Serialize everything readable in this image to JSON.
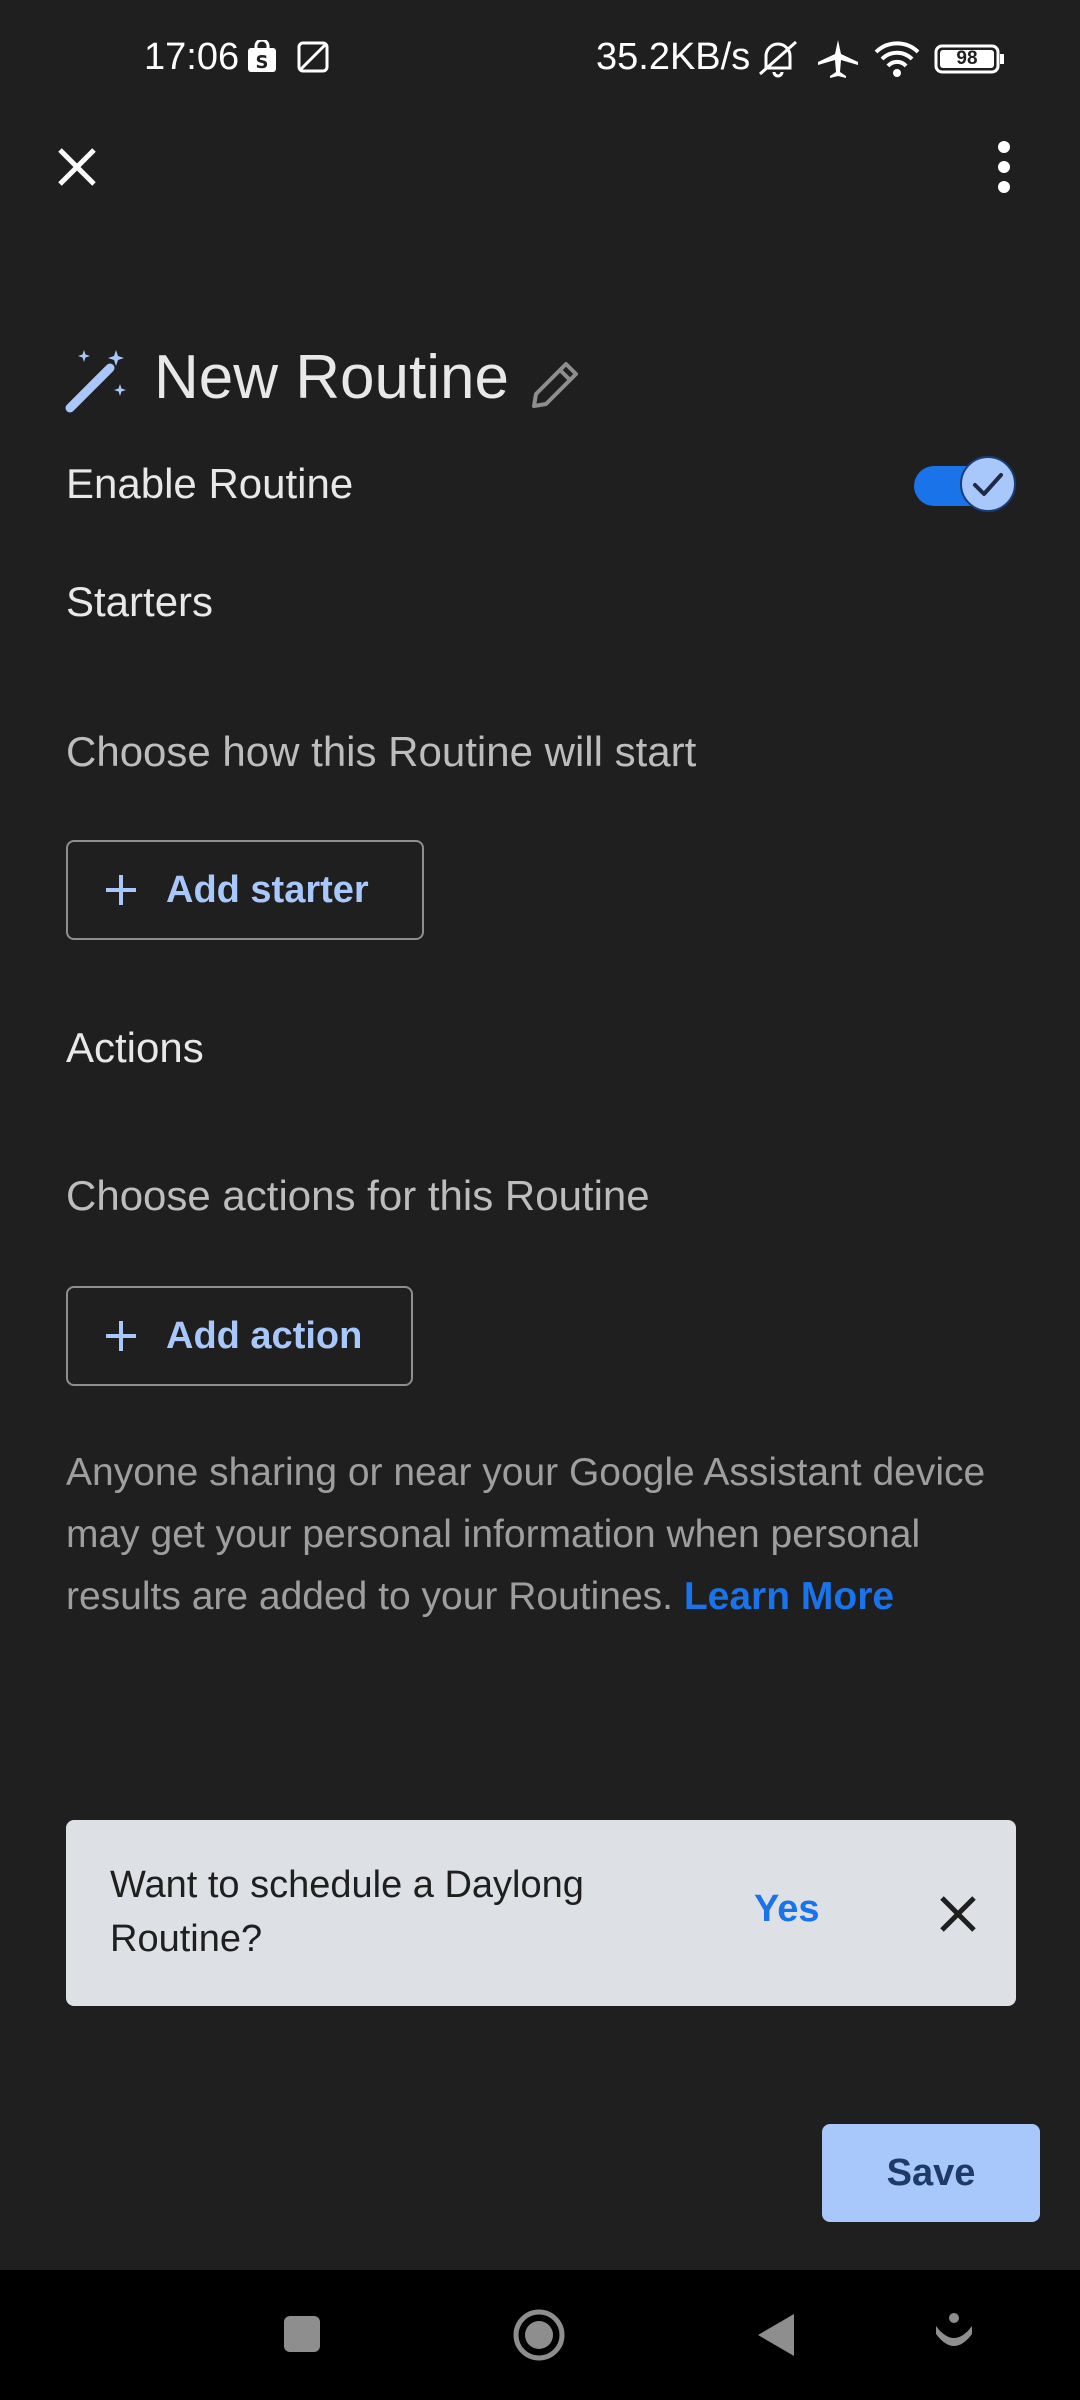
{
  "status_bar": {
    "time": "17:06",
    "network_speed": "35.2KB/s",
    "battery": "98"
  },
  "header": {
    "title": "New Routine"
  },
  "enable": {
    "label": "Enable Routine",
    "enabled": true
  },
  "starters": {
    "heading": "Starters",
    "description": "Choose how this Routine will start",
    "button_label": "Add starter"
  },
  "actions": {
    "heading": "Actions",
    "description": "Choose actions for this Routine",
    "button_label": "Add action"
  },
  "notice": {
    "text": "Anyone sharing or near your Google Assistant device may get your personal information when personal results are added to your Routines. ",
    "link": "Learn More"
  },
  "snackbar": {
    "message": "Want to schedule a Daylong Routine?",
    "action": "Yes"
  },
  "footer": {
    "save_label": "Save"
  },
  "colors": {
    "background": "#1f1f1f",
    "accent": "#a8c7fa",
    "link": "#1a73e8",
    "snackbar": "#dde0e5"
  }
}
